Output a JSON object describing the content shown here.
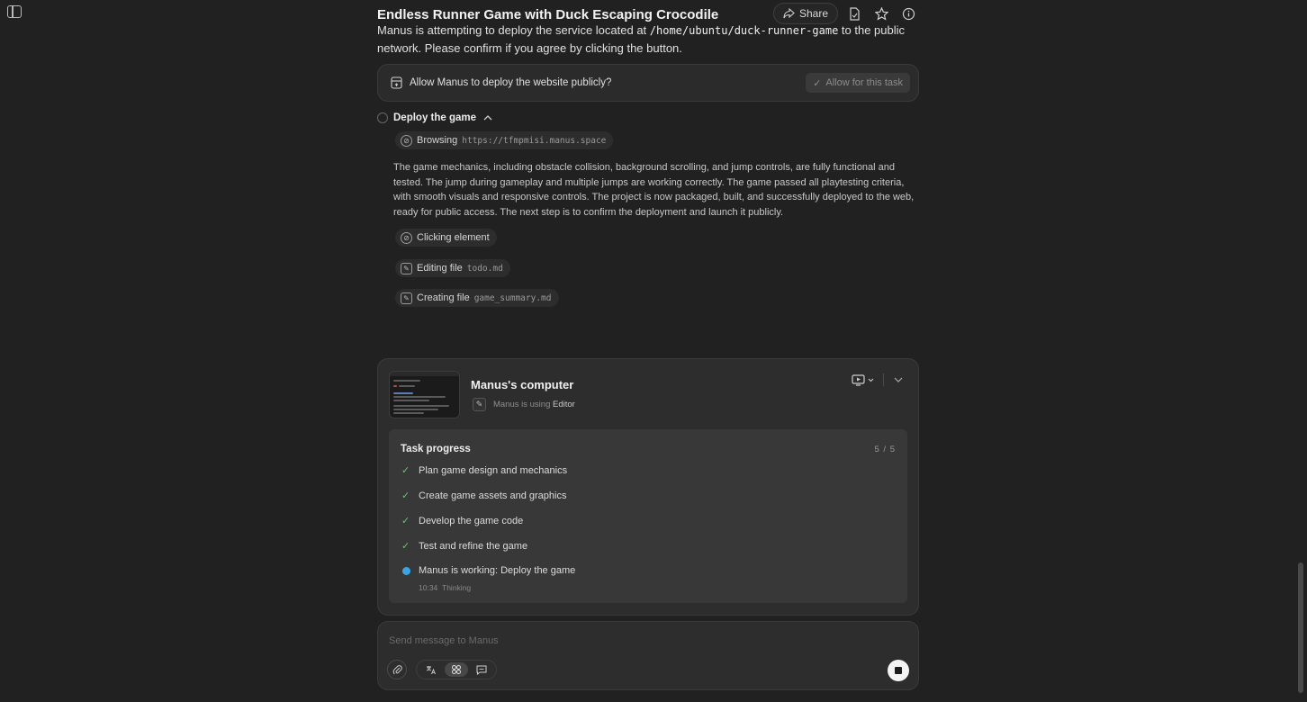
{
  "header": {
    "title": "Endless Runner Game with Duck Escaping Crocodile",
    "share_label": "Share"
  },
  "intro": {
    "text_before": "Manus is attempting to deploy the service located at ",
    "path": "/home/ubuntu/duck-runner-game",
    "text_after": " to the public network. Please confirm if you agree by clicking the button."
  },
  "permission": {
    "text": "Allow Manus to deploy the website publicly?",
    "button_label": "Allow for this task"
  },
  "step": {
    "title": "Deploy the game",
    "browsing_label": "Browsing",
    "browsing_url": "https://tfmpmisi.manus.space",
    "summary": "The game mechanics, including obstacle collision, background scrolling, and jump controls, are fully functional and tested. The jump during gameplay and multiple jumps are working correctly. The game passed all playtesting criteria, with smooth visuals and responsive controls. The project is now packaged, built, and successfully deployed to the web, ready for public access. The next step is to confirm the deployment and launch it publicly.",
    "clicking_label": "Clicking element",
    "editing_label": "Editing file",
    "editing_file": "todo.md",
    "creating_label": "Creating file",
    "creating_file": "game_summary.md"
  },
  "computer": {
    "title": "Manus's computer",
    "using_prefix": "Manus is using",
    "app": "Editor"
  },
  "progress": {
    "title": "Task progress",
    "count": "5 / 5",
    "tasks": [
      "Plan game design and mechanics",
      "Create game assets and graphics",
      "Develop the game code",
      "Test and refine the game",
      "Manus is working: Deploy the game"
    ],
    "current_time": "10:34",
    "current_status": "Thinking"
  },
  "composer": {
    "placeholder": "Send message to Manus"
  },
  "icons": {
    "accent": "#37a6e6",
    "check_color": "#6fbf73"
  }
}
